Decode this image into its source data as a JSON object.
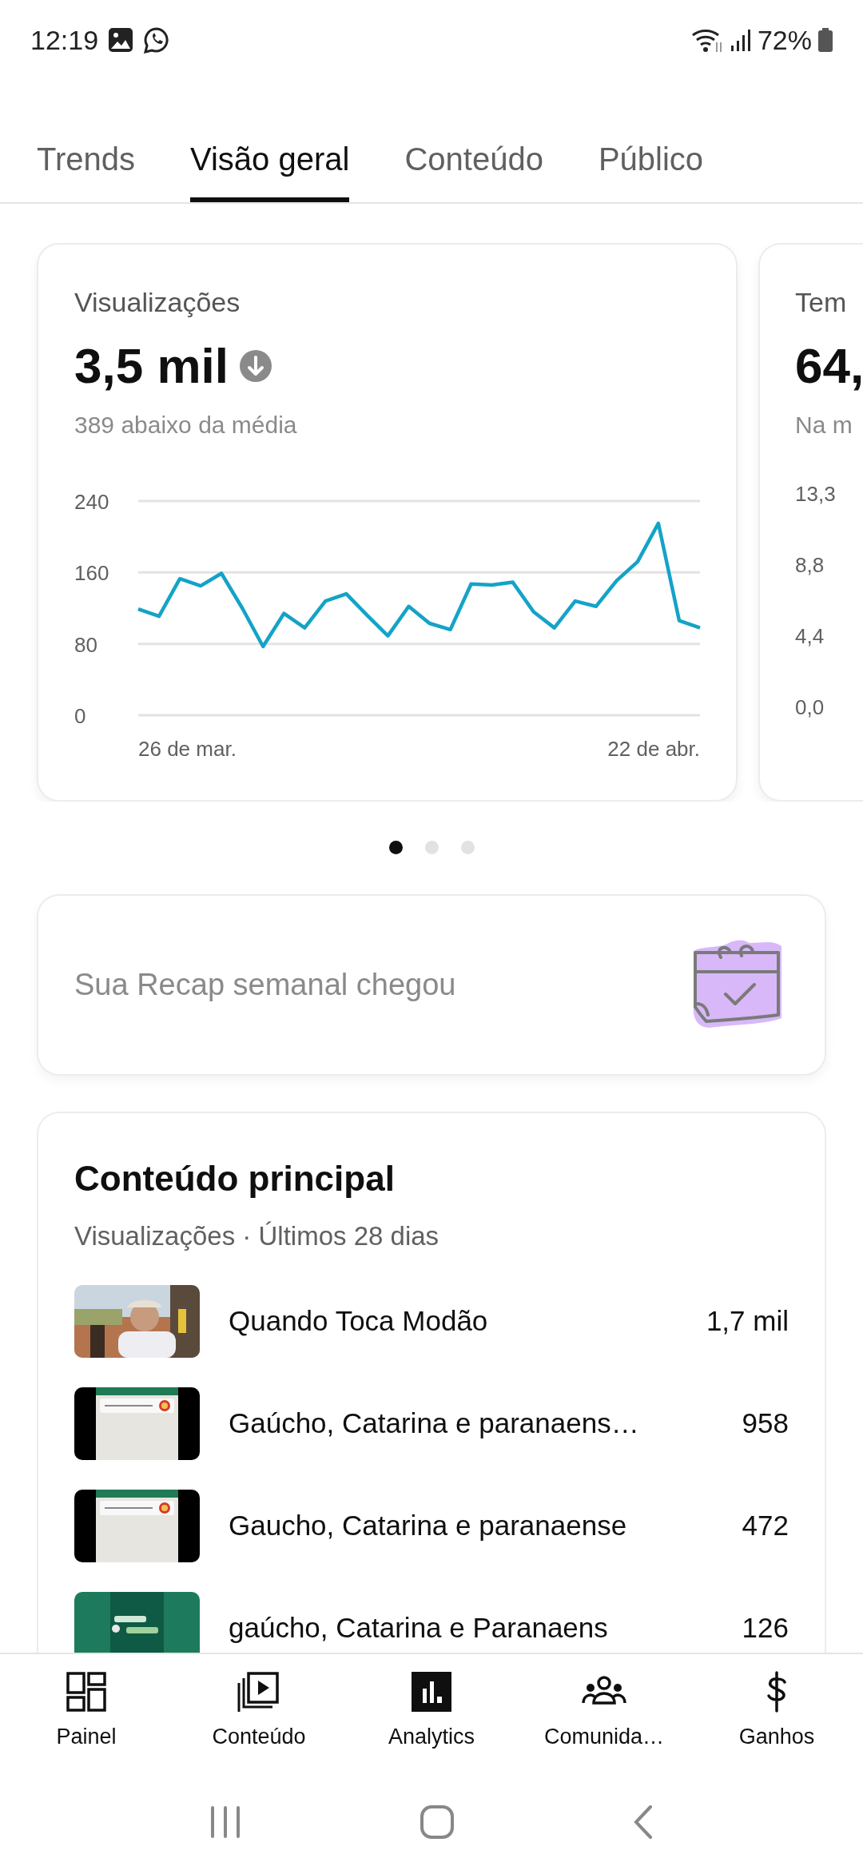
{
  "status_bar": {
    "time": "12:19",
    "battery": "72%"
  },
  "tabs": [
    {
      "label": "Trends",
      "selected": false
    },
    {
      "label": "Visão geral",
      "selected": true
    },
    {
      "label": "Conteúdo",
      "selected": false
    },
    {
      "label": "Público",
      "selected": false
    }
  ],
  "metric_cards": [
    {
      "title": "Visualizações",
      "value": "3,5 mil",
      "trend_down": true,
      "comparison": "389 abaixo da média",
      "x_labels": [
        "26 de mar.",
        "22 de abr."
      ],
      "chart_data": {
        "type": "line",
        "ylim": [
          0,
          240
        ],
        "yticks": [
          0,
          80,
          160,
          240
        ],
        "series": [
          {
            "color": "#14a3c7",
            "values": [
              119,
              111,
              153,
              145,
              159,
              120,
              77,
              114,
              98,
              128,
              136,
              112,
              89,
              122,
              103,
              96,
              147,
              146,
              149,
              116,
              98,
              128,
              122,
              151,
              172,
              215,
              106,
              98
            ]
          }
        ]
      }
    },
    {
      "title": "Tem",
      "value": "64,",
      "comparison": "Na m",
      "y_labels": [
        "13,3",
        "8,8",
        "4,4",
        "0,0"
      ]
    }
  ],
  "carousel_dots": [
    {
      "selected": true
    },
    {
      "selected": false
    },
    {
      "selected": false
    }
  ],
  "recap_banner": {
    "text": "Sua Recap semanal chegou"
  },
  "top_content": {
    "title": "Conteúdo principal",
    "subtitle": "Visualizações · Últimos 28 dias",
    "items": [
      {
        "title": "Quando Toca Modão",
        "views": "1,7 mil"
      },
      {
        "title": "Gaúcho, Catarina e paranaens…",
        "views": "958"
      },
      {
        "title": "Gaucho, Catarina e paranaense",
        "views": "472"
      },
      {
        "title": "gaúcho, Catarina e Paranaens",
        "views": "126"
      }
    ]
  },
  "bottom_nav": [
    {
      "label": "Painel",
      "selected": false
    },
    {
      "label": "Conteúdo",
      "selected": false
    },
    {
      "label": "Analytics",
      "selected": true
    },
    {
      "label": "Comunida…",
      "selected": false
    },
    {
      "label": "Ganhos",
      "selected": false
    }
  ]
}
